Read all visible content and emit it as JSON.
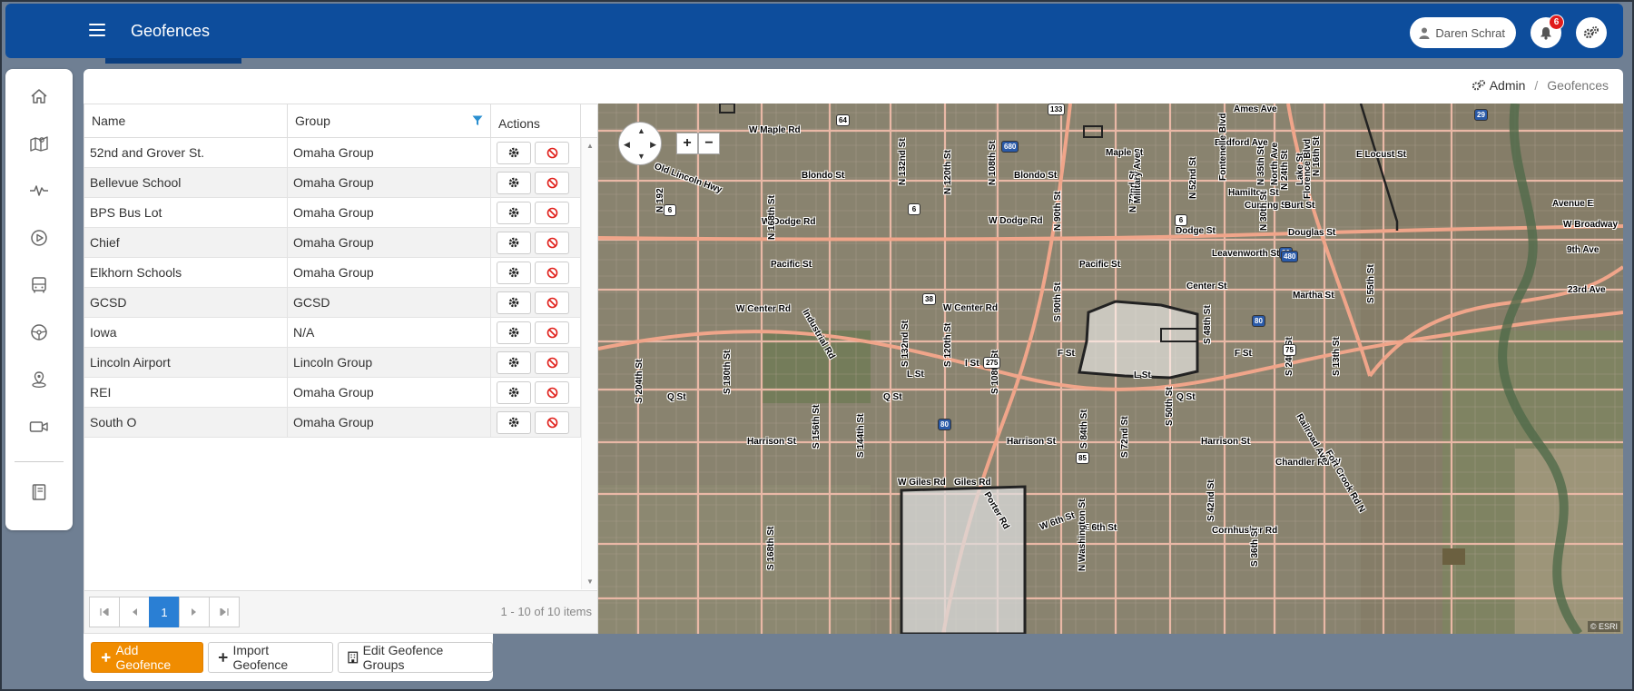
{
  "header": {
    "title": "Geofences",
    "user_name": "Daren Schrat",
    "notification_count": "6"
  },
  "breadcrumb": {
    "admin": "Admin",
    "current": "Geofences"
  },
  "grid": {
    "columns": [
      "Name",
      "Group",
      "Actions"
    ],
    "rows": [
      {
        "name": "52nd and Grover St.",
        "group": "Omaha Group"
      },
      {
        "name": "Bellevue School",
        "group": "Omaha Group"
      },
      {
        "name": "BPS Bus Lot",
        "group": "Omaha Group"
      },
      {
        "name": "Chief",
        "group": "Omaha Group"
      },
      {
        "name": "Elkhorn Schools",
        "group": "Omaha Group"
      },
      {
        "name": "GCSD",
        "group": "GCSD"
      },
      {
        "name": "Iowa",
        "group": "N/A"
      },
      {
        "name": "Lincoln Airport",
        "group": "Lincoln Group"
      },
      {
        "name": "REI",
        "group": "Omaha Group"
      },
      {
        "name": "South O",
        "group": "Omaha Group"
      }
    ],
    "pager": {
      "current_page": "1",
      "info": "1 - 10 of 10 items"
    }
  },
  "toolbar": {
    "add": "Add Geofence",
    "import": "Import Geofence",
    "edit_groups": "Edit Geofence Groups"
  },
  "map": {
    "attribution": "© ESRI",
    "labels": {
      "w_maple": "W Maple Rd",
      "maple": "Maple St",
      "blondo1": "Blondo St",
      "blondo2": "Blondo St",
      "old_lincoln": "Old Lincoln Hwy",
      "w_dodge1": "W Dodge Rd",
      "w_dodge2": "W Dodge Rd",
      "dodge": "Dodge St",
      "pacific1": "Pacific St",
      "pacific2": "Pacific St",
      "w_center1": "W Center Rd",
      "w_center2": "W Center Rd",
      "center": "Center St",
      "leavenworth": "Leavenworth St",
      "hamilton": "Hamilton St",
      "cuming": "Cuming St",
      "burt": "Burt St",
      "douglas": "Douglas St",
      "ames": "Ames Ave",
      "bedford": "Bedford Ave",
      "e_locust": "E Locust St",
      "avenue_e": "Avenue E",
      "w_broadway": "W Broadway",
      "ninth_ave": "9th Ave",
      "martha": "Martha St",
      "twentythird": "23rd Ave",
      "i_st": "I St",
      "l_st1": "L St",
      "l_st2": "L St",
      "f_st1": "F St",
      "f_st2": "F St",
      "q_st1": "Q St",
      "q_st2": "Q St",
      "q_st3": "Q St",
      "harrison1": "Harrison St",
      "harrison2": "Harrison St",
      "harrison3": "Harrison St",
      "w_giles": "W Giles Rd",
      "giles": "Giles Rd",
      "chandler": "Chandler Rd W",
      "cornhusker": "Cornhusker Rd",
      "e_6th": "E 6th St",
      "w_6th": "W 6th St",
      "industrial": "Industrial Rd",
      "railroad": "Railroad Ave",
      "fort_crook": "Fort Crook Rd N",
      "s_204": "S 204th St",
      "s_180": "S 180th St",
      "s_168": "S 168th St",
      "n_168": "N 168th St",
      "n_192": "N 192",
      "s_156": "S 156th St",
      "s_144": "S 144th St",
      "n_132": "N 132nd St",
      "s_132": "S 132nd St",
      "n_120": "N 120th St",
      "s_120": "S 120th St",
      "n_108": "N 108th St",
      "s_108": "S 108th St",
      "n_90": "N 90th St",
      "s_90": "S 90th St",
      "s_84": "S 84th St",
      "n_72": "N 72nd St",
      "s_72": "S 72nd St",
      "n_52": "N 52nd St",
      "s_50": "S 50th St",
      "s_42": "S 42nd St",
      "s_36": "S 36th St",
      "s_24": "S 24th St",
      "s_13": "S 13th St",
      "n_24": "N 24th St",
      "n_30": "N 30th St",
      "s_55": "S 55th St",
      "s_48": "S 48th St",
      "n_wash": "N Washington St",
      "fontenelle": "Fontenelle Blvd",
      "military": "Military Ave",
      "n_16": "N 16th St",
      "florence": "Florence Blvd",
      "lake": "Lake St",
      "north_ave": "North Ave",
      "n_35": "N 35th St",
      "porter": "Porter Rd",
      "shield_680": "680",
      "shield_80a": "80",
      "shield_80b": "80",
      "shield_80c": "80",
      "shield_480": "480",
      "shield_29": "29",
      "shield_6a": "6",
      "shield_6b": "6",
      "shield_6c": "6",
      "shield_64": "64",
      "shield_133": "133",
      "shield_38": "38",
      "shield_275": "275",
      "shield_85": "85",
      "shield_75": "75"
    }
  },
  "colors": {
    "header": "#0d4d9c",
    "accent_orange": "#f08c00",
    "pager_active": "#2a7fd4",
    "delete_red": "#e0201b"
  }
}
